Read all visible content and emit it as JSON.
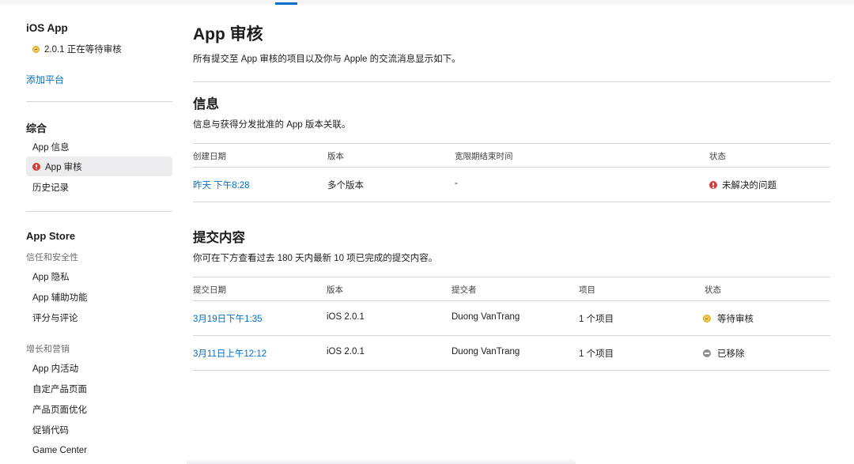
{
  "sidebar": {
    "app_title": "iOS App",
    "version_status": "2.0.1 正在等待审核",
    "add_platform": "添加平台",
    "section_general": "综合",
    "general_items": [
      "App 信息",
      "App 审核",
      "历史记录"
    ],
    "section_appstore": "App Store",
    "sub_trust": "信任和安全性",
    "trust_items": [
      "App 隐私",
      "App 辅助功能",
      "评分与评论"
    ],
    "sub_growth": "增长和营销",
    "growth_items": [
      "App 内活动",
      "自定产品页面",
      "产品页面优化",
      "促销代码",
      "Game Center"
    ]
  },
  "main": {
    "title": "App 审核",
    "description": "所有提交至 App 审核的项目以及你与 Apple 的交流消息显示如下。",
    "info": {
      "title": "信息",
      "description": "信息与获得分发批准的 App 版本关联。",
      "headers": [
        "创建日期",
        "版本",
        "宽限期结束时间",
        "状态"
      ],
      "row": {
        "date": "昨天 下午8:28",
        "version": "多个版本",
        "grace": "-",
        "status": "未解决的问题"
      }
    },
    "submissions": {
      "title": "提交内容",
      "description": "你可在下方查看过去 180 天内最新 10 项已完成的提交内容。",
      "headers": [
        "提交日期",
        "版本",
        "提交者",
        "项目",
        "状态"
      ],
      "rows": [
        {
          "date": "3月19日下午1:35",
          "version": "iOS 2.0.1",
          "submitter": "Duong VanTrang",
          "items": "1 个项目",
          "status": "等待审核"
        },
        {
          "date": "3月11日上午12:12",
          "version": "iOS 2.0.1",
          "submitter": "Duong VanTrang",
          "items": "1 个项目",
          "status": "已移除"
        }
      ]
    }
  },
  "colors": {
    "link": "#0070c9",
    "status_waiting": "#f2c94c",
    "status_issue": "#d93a3a",
    "status_removed": "#8e8e93"
  },
  "icons": {
    "waiting": "yellow-status-dot-icon",
    "issue": "red-alert-dot-icon",
    "removed": "gray-minus-dot-icon"
  }
}
